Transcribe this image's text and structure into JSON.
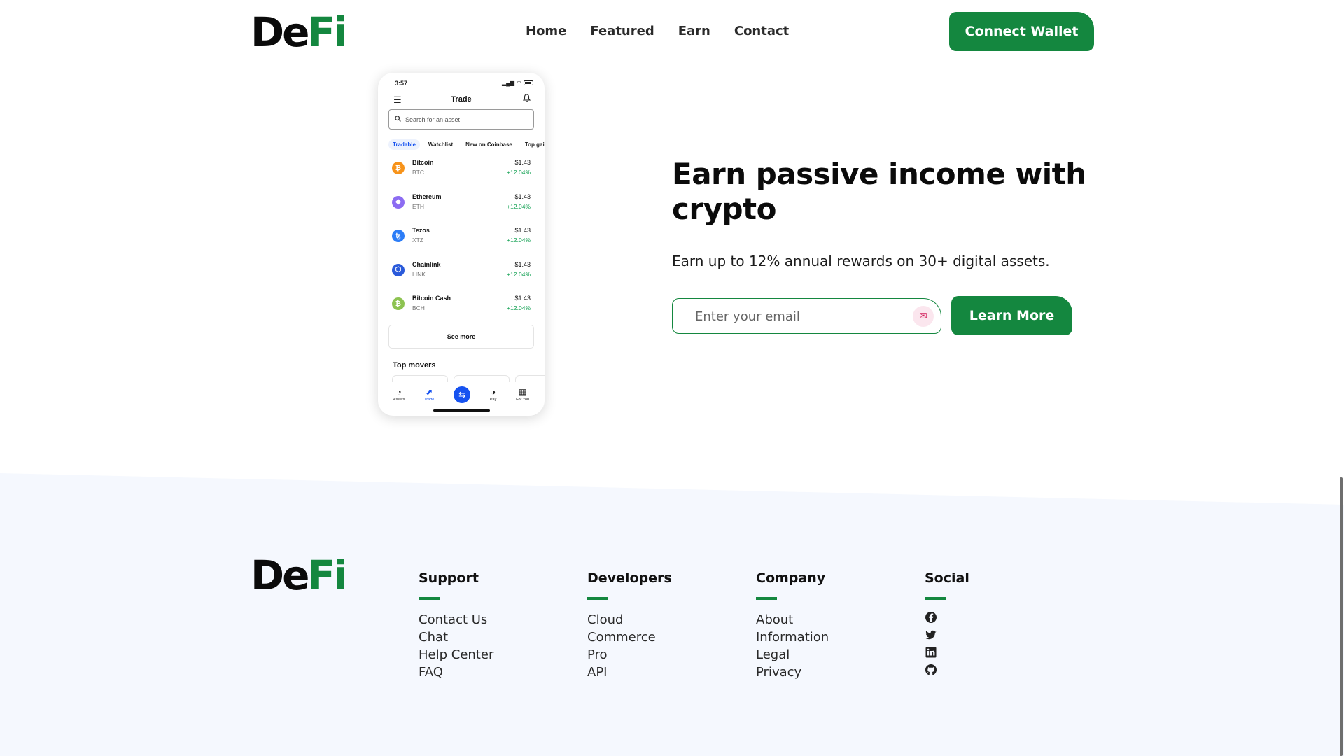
{
  "header": {
    "logo": {
      "part1": "De",
      "part2": "Fi"
    },
    "nav": [
      "Home",
      "Featured",
      "Earn",
      "Contact"
    ],
    "connect_label": "Connect Wallet"
  },
  "phone": {
    "time": "3:57",
    "title": "Trade",
    "search_placeholder": "Search for an asset",
    "tabs": [
      "Tradable",
      "Watchlist",
      "New on Coinbase",
      "Top gainers"
    ],
    "assets": [
      {
        "name": "Bitcoin",
        "symbol": "BTC",
        "price": "$1.43",
        "change": "+12.04%",
        "glyph": "₿",
        "color": "#f7931a"
      },
      {
        "name": "Ethereum",
        "symbol": "ETH",
        "price": "$1.43",
        "change": "+12.04%",
        "glyph": "◆",
        "color": "#8c6cf2"
      },
      {
        "name": "Tezos",
        "symbol": "XTZ",
        "price": "$1.43",
        "change": "+12.04%",
        "glyph": "ꜩ",
        "color": "#2c7df7"
      },
      {
        "name": "Chainlink",
        "symbol": "LINK",
        "price": "$1.43",
        "change": "+12.04%",
        "glyph": "⬡",
        "color": "#2a5ada"
      },
      {
        "name": "Bitcoin Cash",
        "symbol": "BCH",
        "price": "$1.43",
        "change": "+12.04%",
        "glyph": "₿",
        "color": "#8dc351"
      }
    ],
    "see_more": "See more",
    "top_movers": "Top movers",
    "bottom_nav": [
      {
        "label": "Assets",
        "icon": "pie-chart-icon"
      },
      {
        "label": "Trade",
        "icon": "trend-icon"
      },
      {
        "label": "Pay",
        "icon": "pay-icon"
      },
      {
        "label": "For You",
        "icon": "grid-icon"
      }
    ]
  },
  "hero": {
    "title": "Earn passive income with crypto",
    "subtitle": "Earn up to 12% annual rewards on 30+ digital assets.",
    "email_placeholder": "Enter your email",
    "learn_more": "Learn More"
  },
  "footer": {
    "logo": {
      "part1": "De",
      "part2": "Fi"
    },
    "columns": [
      {
        "title": "Support",
        "links": [
          "Contact Us",
          "Chat",
          "Help Center",
          "FAQ"
        ]
      },
      {
        "title": "Developers",
        "links": [
          "Cloud",
          "Commerce",
          "Pro",
          "API"
        ]
      },
      {
        "title": "Company",
        "links": [
          "About",
          "Information",
          "Legal",
          "Privacy"
        ]
      },
      {
        "title": "Social",
        "icons": [
          "facebook-icon",
          "twitter-icon",
          "linkedin-icon",
          "github-icon"
        ]
      }
    ]
  },
  "colors": {
    "brand_green": "#14873f",
    "footer_bg": "#f5f8fe",
    "phone_accent": "#1652f0",
    "positive": "#0e9f4f"
  }
}
